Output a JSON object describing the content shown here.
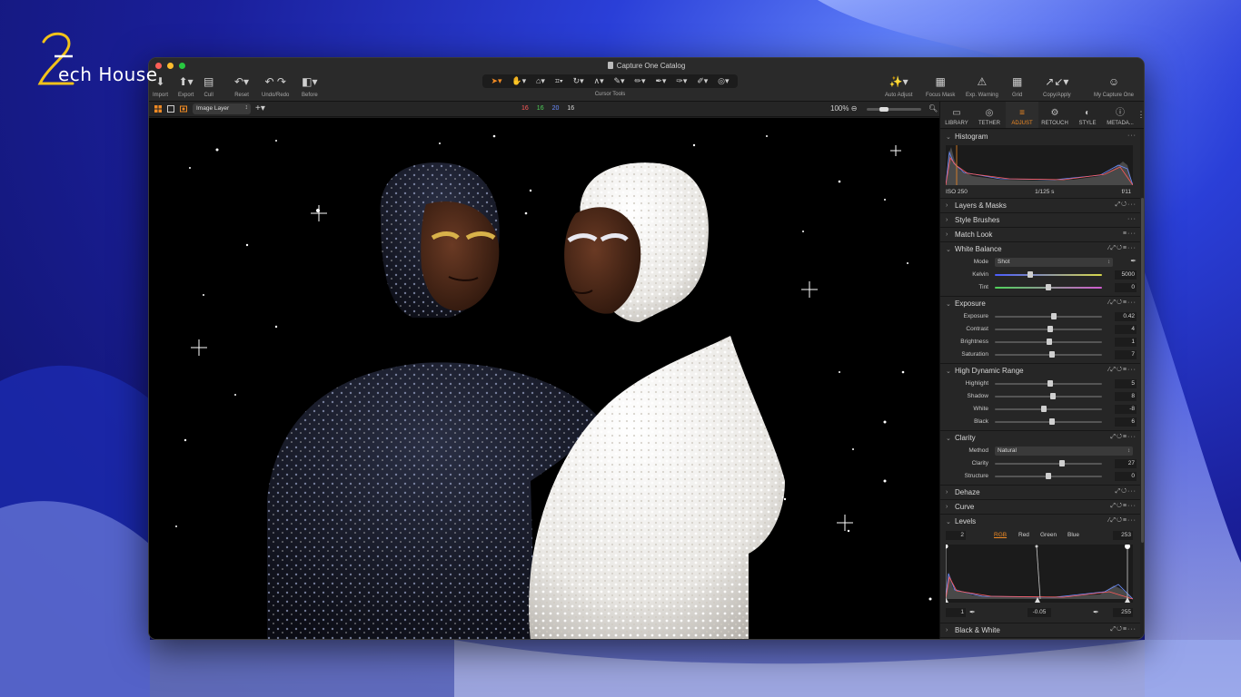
{
  "logo": {
    "digit": "2",
    "text": "ech House"
  },
  "window": {
    "title": "Capture One Catalog",
    "colors": {
      "accent": "#f08a24",
      "close": "#ff5f57",
      "minimize": "#febc2e",
      "zoom": "#28c840"
    }
  },
  "toolbar": {
    "left": [
      {
        "label": "Import",
        "icon": "import-icon"
      },
      {
        "label": "Export",
        "icon": "export-icon"
      },
      {
        "label": "Cull",
        "icon": "cull-icon"
      },
      {
        "label": "Reset",
        "icon": "reset-icon"
      },
      {
        "label": "Undo/Redo",
        "icon": "undo-redo-icon"
      },
      {
        "label": "Before",
        "icon": "before-icon"
      }
    ],
    "cursor_tools_label": "Cursor Tools",
    "right": [
      {
        "label": "Auto Adjust",
        "icon": "auto-adjust-icon"
      },
      {
        "label": "Focus Mask",
        "icon": "focus-mask-icon"
      },
      {
        "label": "Exp. Warning",
        "icon": "warning-icon"
      },
      {
        "label": "Grid",
        "icon": "grid-icon"
      },
      {
        "label": "Copy/Apply",
        "icon": "copy-apply-icon"
      },
      {
        "label": "My Capture One",
        "icon": "user-icon"
      }
    ]
  },
  "subbar": {
    "layer": "Image Layer",
    "counts": [
      {
        "value": "16",
        "color": "#ff5a5a"
      },
      {
        "value": "16",
        "color": "#4fd35a"
      },
      {
        "value": "20",
        "color": "#6a8cff"
      },
      {
        "value": "16",
        "color": "#d8d8d8"
      }
    ],
    "zoom": "100%"
  },
  "tabs": [
    {
      "label": "LIBRARY",
      "icon": "folder-icon",
      "active": false
    },
    {
      "label": "TETHER",
      "icon": "camera-icon",
      "active": false
    },
    {
      "label": "ADJUST",
      "icon": "sliders-icon",
      "active": true
    },
    {
      "label": "RETOUCH",
      "icon": "retouch-icon",
      "active": false
    },
    {
      "label": "STYLE",
      "icon": "style-icon",
      "active": false
    },
    {
      "label": "METADA...",
      "icon": "info-icon",
      "active": false
    }
  ],
  "histogram": {
    "title": "Histogram",
    "iso": "ISO 250",
    "shutter": "1/125 s",
    "aperture": "f/11"
  },
  "sections": {
    "layers_masks": "Layers & Masks",
    "style_brushes": "Style Brushes",
    "match_look": "Match Look",
    "white_balance": {
      "title": "White Balance",
      "mode_label": "Mode",
      "mode_value": "Shot",
      "kelvin_label": "Kelvin",
      "kelvin_value": "5000",
      "kelvin_pos": 0.33,
      "tint_label": "Tint",
      "tint_value": "0",
      "tint_pos": 0.5
    },
    "exposure": {
      "title": "Exposure",
      "rows": [
        {
          "label": "Exposure",
          "value": "0.42",
          "pos": 0.55
        },
        {
          "label": "Contrast",
          "value": "4",
          "pos": 0.52
        },
        {
          "label": "Brightness",
          "value": "1",
          "pos": 0.51
        },
        {
          "label": "Saturation",
          "value": "7",
          "pos": 0.53
        }
      ]
    },
    "hdr": {
      "title": "High Dynamic Range",
      "rows": [
        {
          "label": "Highlight",
          "value": "5",
          "pos": 0.52
        },
        {
          "label": "Shadow",
          "value": "8",
          "pos": 0.54
        },
        {
          "label": "White",
          "value": "-8",
          "pos": 0.46
        },
        {
          "label": "Black",
          "value": "6",
          "pos": 0.53
        }
      ]
    },
    "clarity": {
      "title": "Clarity",
      "method_label": "Method",
      "method_value": "Natural",
      "rows": [
        {
          "label": "Clarity",
          "value": "27",
          "pos": 0.63
        },
        {
          "label": "Structure",
          "value": "0",
          "pos": 0.5
        }
      ]
    },
    "dehaze": "Dehaze",
    "curve": "Curve",
    "levels": {
      "title": "Levels",
      "left_value": "2",
      "right_value": "253",
      "channels": [
        "RGB",
        "Red",
        "Green",
        "Blue"
      ],
      "active_channel": "RGB",
      "bottom_left": "1",
      "bottom_mid": "-0.05",
      "bottom_right": "255"
    },
    "black_white": "Black & White"
  }
}
